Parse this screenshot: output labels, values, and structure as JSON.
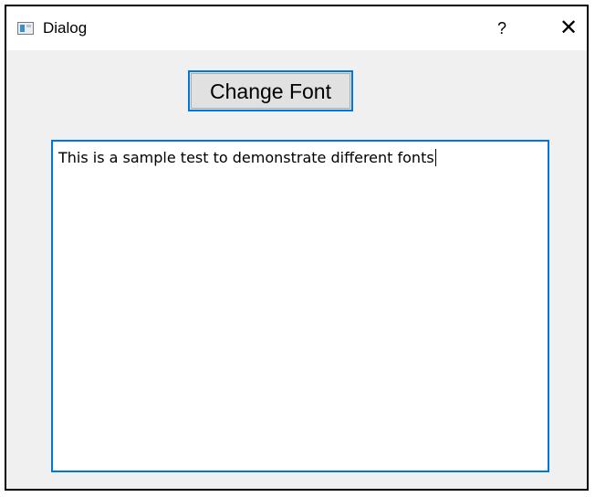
{
  "window": {
    "title": "Dialog",
    "help_label": "?",
    "close_label": "✕"
  },
  "toolbar": {
    "change_font_label": "Change Font"
  },
  "editor": {
    "text": "This is a sample test to demonstrate different fonts"
  },
  "colors": {
    "focus_border": "#0078d7",
    "window_bg": "#f0f0f0",
    "button_bg": "#e1e1e1"
  }
}
